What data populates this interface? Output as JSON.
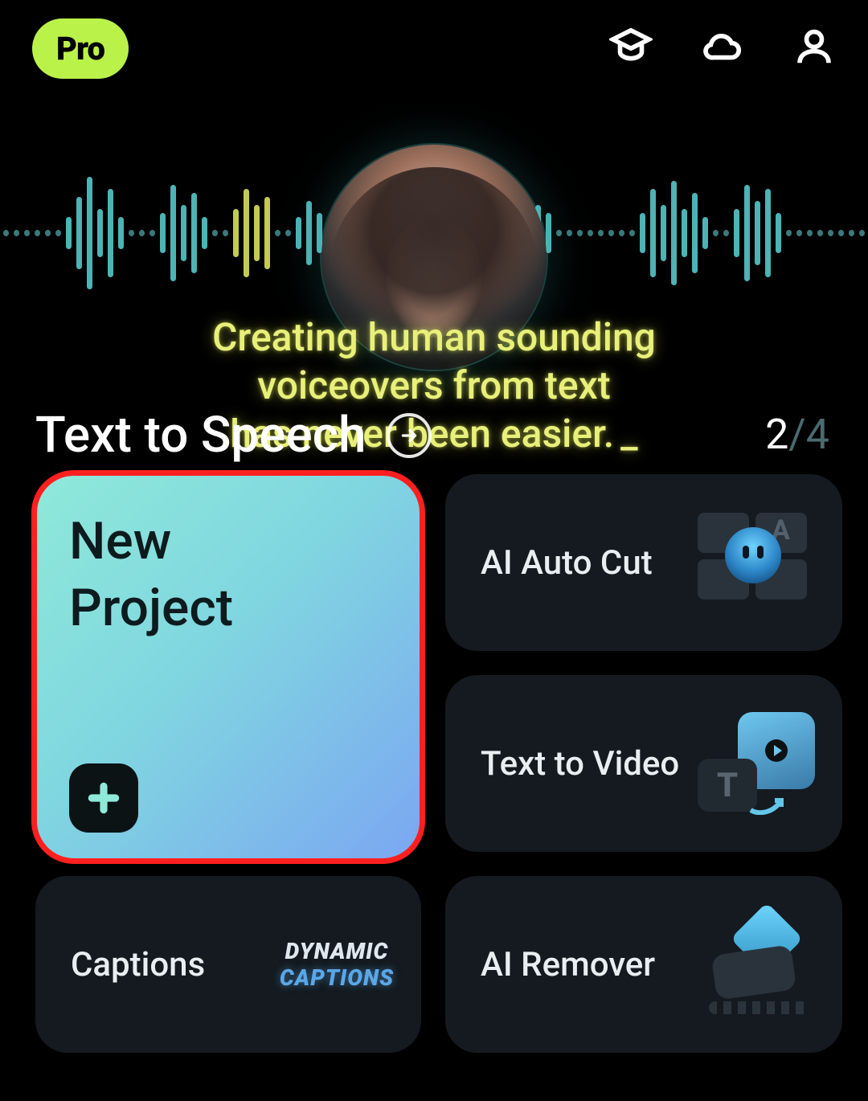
{
  "header": {
    "badge": "Pro"
  },
  "hero": {
    "tagline_l1": "Creating human sounding",
    "tagline_l2": "voiceovers from text",
    "tagline_l3": "has never been easier.",
    "section_title": "Text to Speech",
    "pager_current": "2",
    "pager_total": "4"
  },
  "tiles": {
    "new_project": "New\nProject",
    "ai_auto_cut": "AI Auto Cut",
    "text_to_video": "Text to Video",
    "captions": "Captions",
    "ai_remover": "AI Remover",
    "dynamic_line1": "DYNAMIC",
    "dynamic_line2": "CAPTIONS",
    "ttv_T": "T",
    "autocut_A": "A"
  }
}
